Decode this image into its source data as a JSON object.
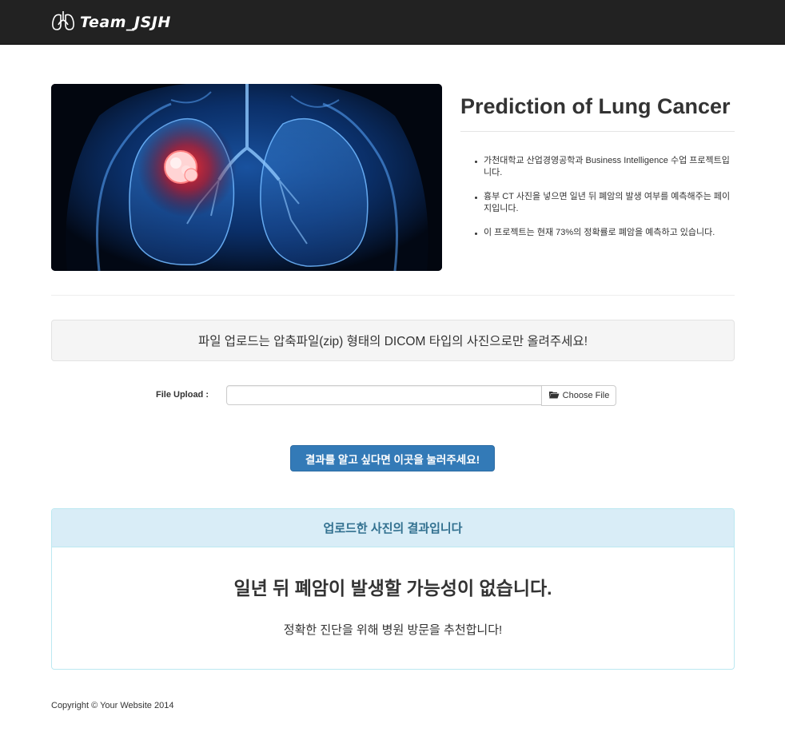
{
  "navbar": {
    "brand_text": "Team_JSJH",
    "brand_icon": "lungs-icon"
  },
  "hero": {
    "image": "lung-xray-illustration"
  },
  "intro": {
    "title": "Prediction of Lung Cancer",
    "bullets": [
      "가천대학교 산업경영공학과 Business Intelligence 수업 프로젝트입니다.",
      "흉부 CT 사진을 넣으면 일년 뒤 폐암의 발생 여부를 예측해주는 페이지입니다.",
      "이 프로젝트는 현재 73%의 정확률로 폐암을 예측하고 있습니다."
    ]
  },
  "notice": {
    "text": "파일 업로드는 압축파일(zip) 형태의 DICOM 타입의 사진으로만 올려주세요!"
  },
  "upload": {
    "label": "File Upload :",
    "value": "",
    "button_label": "Choose File",
    "button_icon": "folder-open-icon"
  },
  "submit": {
    "label": "결과를 알고 싶다면 이곳을 눌러주세요!"
  },
  "result": {
    "heading": "업로드한 사진의 결과입니다",
    "main": "일년 뒤 폐암이 발생할 가능성이 없습니다.",
    "sub": "정확한 진단을 위해 병원 방문을 추천합니다!"
  },
  "footer": {
    "copyright": "Copyright © Your Website 2014"
  },
  "colors": {
    "navbar_bg": "#222222",
    "primary": "#337ab7",
    "info_bg": "#d9edf7",
    "info_text": "#31708f",
    "info_border": "#bce8f1",
    "well_bg": "#f5f5f5"
  }
}
